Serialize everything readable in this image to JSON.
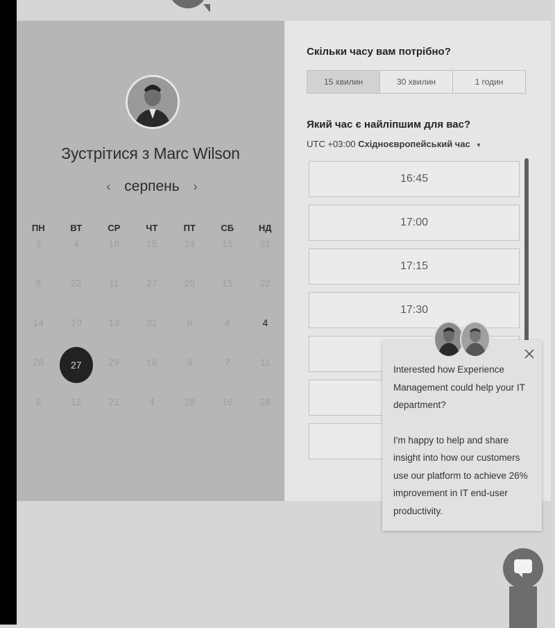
{
  "meeting": {
    "title": "Зустрітися з Marc Wilson",
    "month": "серпень",
    "prev_icon": "chevron-left-icon",
    "next_icon": "chevron-right-icon"
  },
  "calendar": {
    "weekdays": [
      "ПН",
      "ВТ",
      "СР",
      "ЧТ",
      "ПТ",
      "СБ",
      "НД"
    ],
    "weeks": [
      [
        "3",
        "4",
        "18",
        "15",
        "24",
        "15",
        "21"
      ],
      [
        "9",
        "22",
        "11",
        "27",
        "20",
        "15",
        "22"
      ],
      [
        "14",
        "10",
        "13",
        "31",
        "6",
        "4",
        "4"
      ],
      [
        "26",
        "27",
        "29",
        "18",
        "9",
        "7",
        "11"
      ],
      [
        "6",
        "12",
        "21",
        "4",
        "28",
        "16",
        "28"
      ]
    ],
    "selected": "27",
    "available": [
      "4"
    ]
  },
  "duration": {
    "question": "Скільки часу вам потрібно?",
    "options": [
      "15 хвилин",
      "30 хвилин",
      "1 годин"
    ],
    "selected": "15 хвилин"
  },
  "timeslots": {
    "question": "Який час є найліпшим для вас?",
    "tz_offset": "UTC +03:00",
    "tz_name": "Східноєвропейський час",
    "slots": [
      "16:45",
      "17:00",
      "17:15",
      "17:30",
      "",
      "",
      "",
      ""
    ]
  },
  "chat": {
    "paragraph1": "Interested how Experience Management could help your IT department?",
    "paragraph2": "I'm happy to help and share insight into how our customers use our platform to achieve 26% improvement in IT end-user productivity.",
    "close_icon": "close-icon",
    "launcher_icon": "chat-bubble-icon"
  }
}
